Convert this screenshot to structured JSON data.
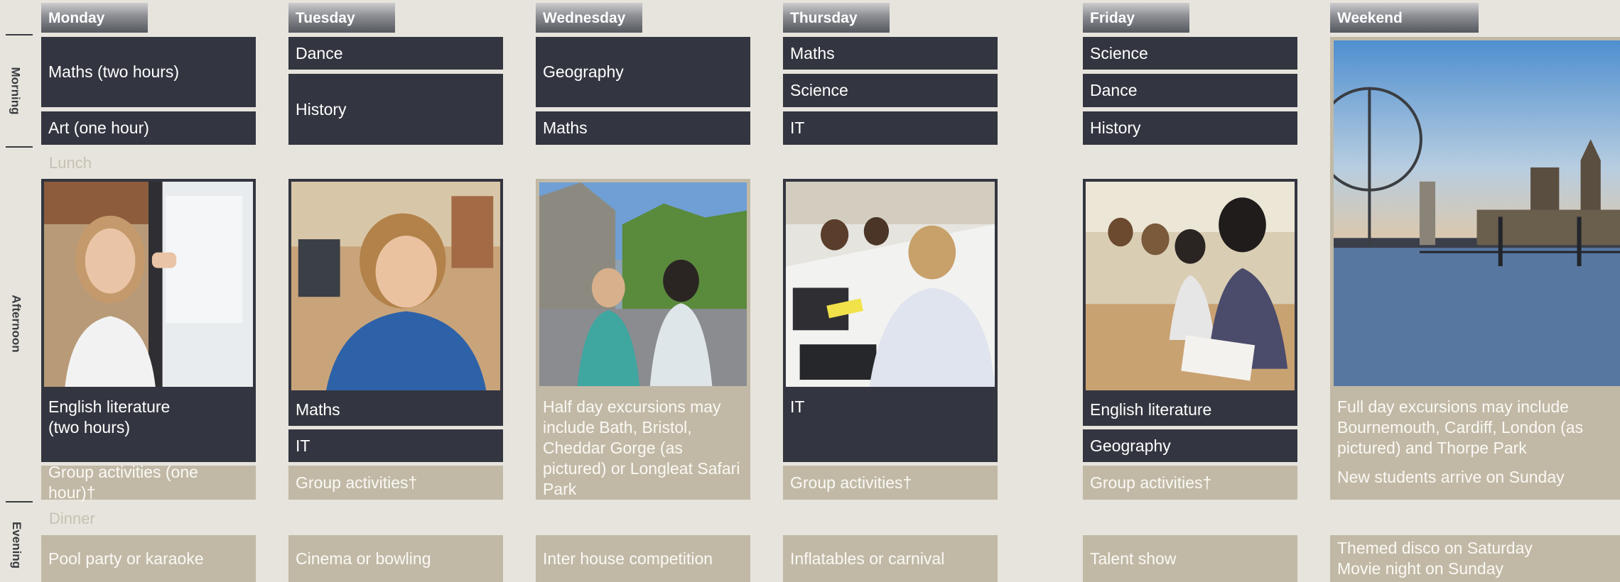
{
  "side": {
    "morning": "Morning",
    "afternoon": "Afternoon",
    "evening": "Evening"
  },
  "breaks": {
    "lunch": "Lunch",
    "dinner": "Dinner"
  },
  "days": {
    "monday": {
      "name": "Monday",
      "morning1": "Maths (two hours)",
      "morning2": "Art (one hour)",
      "afternoon1": "English literature\n(two hours)",
      "group": "Group activities (one hour)†",
      "evening": "Pool party or karaoke"
    },
    "tuesday": {
      "name": "Tuesday",
      "morning1": "Dance",
      "morning2": "History",
      "afternoon1": "Maths",
      "afternoon2": "IT",
      "group": "Group activities†",
      "evening": "Cinema or bowling"
    },
    "wednesday": {
      "name": "Wednesday",
      "morning1": "Geography",
      "morning2": "Maths",
      "afternoon1": "Half day excursions may include Bath, Bristol, Cheddar Gorge (as pictured) or Longleat Safari Park",
      "evening": "Inter house competition"
    },
    "thursday": {
      "name": "Thursday",
      "morning1": "Maths",
      "morning2": "Science",
      "morning3": "IT",
      "afternoon1": "IT",
      "group": "Group activities†",
      "evening": "Inflatables or carnival"
    },
    "friday": {
      "name": "Friday",
      "morning1": "Science",
      "morning2": "Dance",
      "morning3": "History",
      "afternoon1": "English literature",
      "afternoon2": "Geography",
      "group": "Group activities†",
      "evening": "Talent show"
    },
    "weekend": {
      "name": "Weekend",
      "afternoon1": "Full day excursions may include Bournemouth, Cardiff, London (as pictured) and Thorpe Park",
      "afternoon2": "New students arrive on Sunday",
      "evening1": "Themed disco on Saturday",
      "evening2": "Movie night on Sunday"
    }
  },
  "colors": {
    "background": "#e7e4dd",
    "dark_cell": "#333640",
    "tan_cell": "#c1b9a6"
  }
}
